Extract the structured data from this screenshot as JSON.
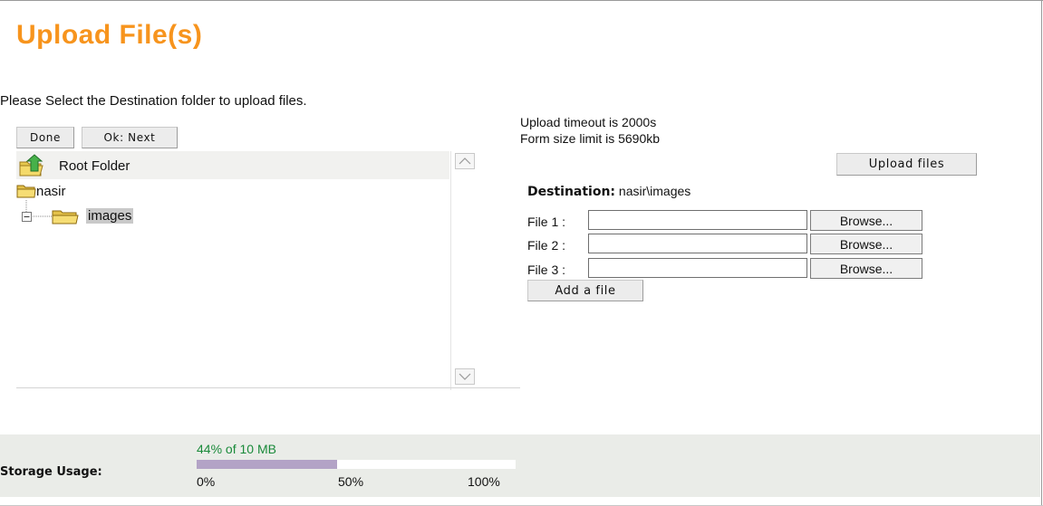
{
  "page": {
    "title": "Upload File(s)",
    "instructions": "Please Select the Destination folder to upload files."
  },
  "tree_toolbar": {
    "done_label": "Done",
    "next_label": "Ok: Next"
  },
  "folder_tree": {
    "root_label": "Root Folder",
    "nodes": [
      {
        "label": "nasir"
      },
      {
        "label": "images",
        "selected": true
      }
    ]
  },
  "upload_info": {
    "timeout": "Upload timeout is 2000s",
    "size_limit": "Form size limit is 5690kb"
  },
  "upload_button_label": "Upload files",
  "destination": {
    "label": "Destination:",
    "path": "nasir\\images"
  },
  "file_fields": [
    {
      "label": "File 1 :",
      "value": "",
      "browse_label": "Browse..."
    },
    {
      "label": "File 2 :",
      "value": "",
      "browse_label": "Browse..."
    },
    {
      "label": "File 3 :",
      "value": "",
      "browse_label": "Browse..."
    }
  ],
  "add_file_label": "Add a file",
  "storage": {
    "label": "Storage Usage:",
    "amount_text": "44% of 10 MB",
    "used_fraction": 0.44,
    "tick_labels": [
      "0%",
      "50%",
      "100%"
    ],
    "bar_color": "#b3a3c6",
    "amount_color": "#1a8a3a"
  },
  "colors": {
    "title": "#f7941d",
    "storage_panel_bg": "#eaece8",
    "selected_node_bg": "#c9c9c9"
  },
  "icons": {
    "root": "root-folder-up-arrow-icon",
    "folder": "folder-icon",
    "tree_toggle": "tree-collapse-minus-icon",
    "scroll_up": "chevron-up-icon",
    "scroll_down": "chevron-down-icon"
  }
}
